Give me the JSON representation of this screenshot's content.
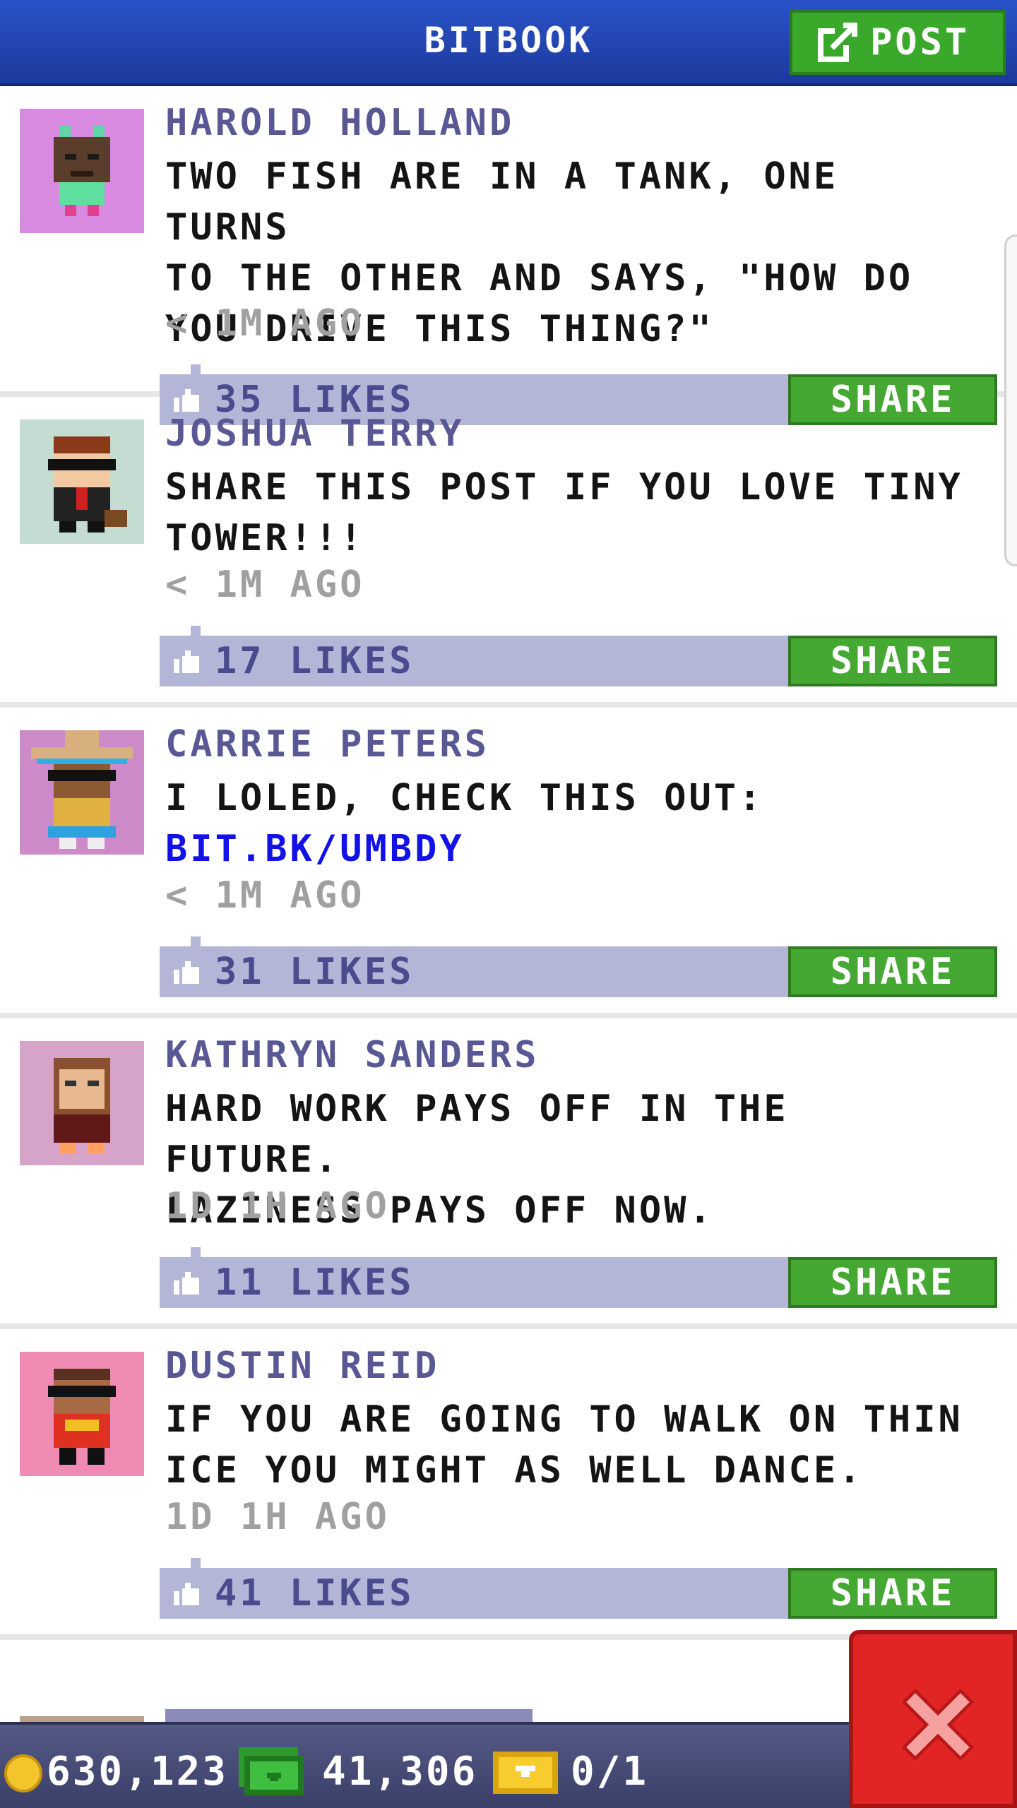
{
  "header": {
    "title": "BITBOOK",
    "post_label": "POST"
  },
  "posts": [
    {
      "author": "HAROLD HOLLAND",
      "message": "TWO FISH ARE IN A TANK, ONE TURNS\nTO THE OTHER AND SAYS, \"HOW DO\nYOU DRIVE THIS THING?\"",
      "time": "< 1M AGO",
      "likes": "35 LIKES",
      "share": "SHARE",
      "avatar_color": "#d88ae0"
    },
    {
      "author": "JOSHUA TERRY",
      "message": "SHARE THIS POST IF YOU LOVE TINY\nTOWER!!!",
      "time": "< 1M AGO",
      "likes": "17 LIKES",
      "share": "SHARE",
      "avatar_color": "#c4dcd2"
    },
    {
      "author": "CARRIE PETERS",
      "message": "I LOLED, CHECK THIS OUT:",
      "link": "BIT.BK/UMBDY",
      "time": "< 1M AGO",
      "likes": "31 LIKES",
      "share": "SHARE",
      "avatar_color": "#cc8ac8"
    },
    {
      "author": "KATHRYN SANDERS",
      "message": "HARD WORK PAYS OFF IN THE FUTURE.\nLAZINESS PAYS OFF NOW.",
      "time": "1D 1H AGO",
      "likes": "11 LIKES",
      "share": "SHARE",
      "avatar_color": "#d6a4c8"
    },
    {
      "author": "DUSTIN REID",
      "message": "IF YOU ARE GOING TO WALK ON THIN\nICE YOU MIGHT AS WELL DANCE.",
      "time": "1D 1H AGO",
      "likes": "41 LIKES",
      "share": "SHARE",
      "avatar_color": "#f08cb4"
    }
  ],
  "bottom_bar": {
    "coins": "630,123",
    "bux": "41,306",
    "tickets": "0/1"
  },
  "icons": {
    "post": "edit-icon",
    "like": "thumbs-up-icon",
    "coin": "coin-icon",
    "bux": "bux-icon",
    "ticket": "ticket-icon",
    "close": "close-icon"
  },
  "colors": {
    "header": "#2a52c8",
    "share_green": "#44a832",
    "likes_bar": "#b4b6d8",
    "author": "#5a5894",
    "link": "#1212e6",
    "close_red": "#e12525"
  }
}
